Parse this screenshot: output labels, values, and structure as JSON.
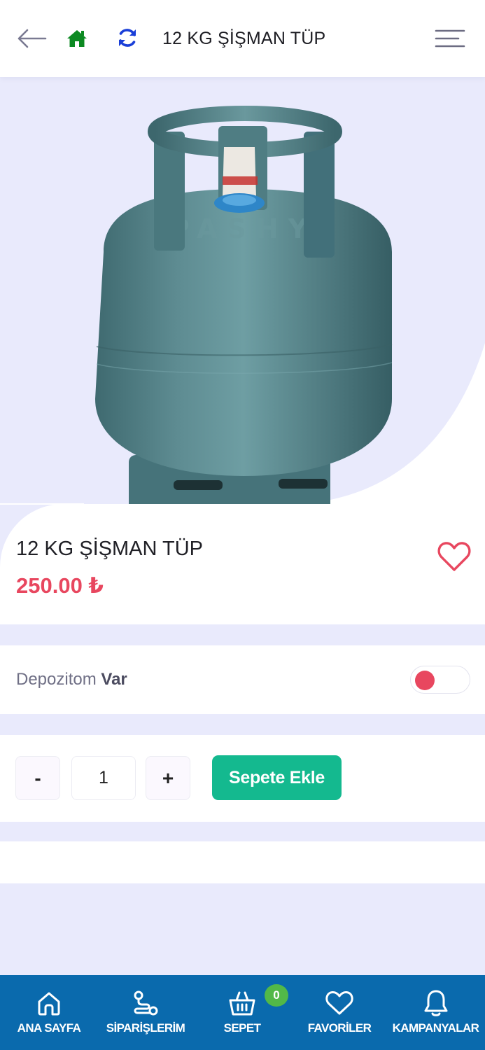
{
  "header": {
    "title": "12 KG ŞİŞMAN TÜP",
    "icons": [
      "arrow-left-icon",
      "home-icon",
      "refresh-icon",
      "menu-icon"
    ]
  },
  "colors": {
    "background": "#e9eafc",
    "accent_red": "#e8475f",
    "accent_green": "#14b98f",
    "nav_blue": "#0a6aad",
    "home_green": "#0c8a22",
    "refresh_blue": "#1a3fd8",
    "badge_green": "#52b848"
  },
  "product": {
    "name": "12 KG ŞİŞMAN TÜP",
    "price": "250.00 ₺",
    "image_icon": "gas-cylinder-icon",
    "favorite_icon": "heart-outline-icon"
  },
  "deposit": {
    "label": "Depozitom",
    "value": "Var",
    "toggle_on": false
  },
  "cart_controls": {
    "minus": "-",
    "quantity": "1",
    "plus": "+",
    "add_to_cart": "Sepete Ekle"
  },
  "bottom_nav": {
    "items": [
      {
        "label": "ANA SAYFA",
        "icon": "home-outline-icon"
      },
      {
        "label": "SİPARİŞLERİM",
        "icon": "route-icon"
      },
      {
        "label": "SEPET",
        "icon": "basket-icon"
      },
      {
        "label": "FAVORİLER",
        "icon": "heart-outline-icon"
      },
      {
        "label": "KAMPANYALAR",
        "icon": "bell-icon"
      }
    ],
    "cart_count": "0"
  }
}
